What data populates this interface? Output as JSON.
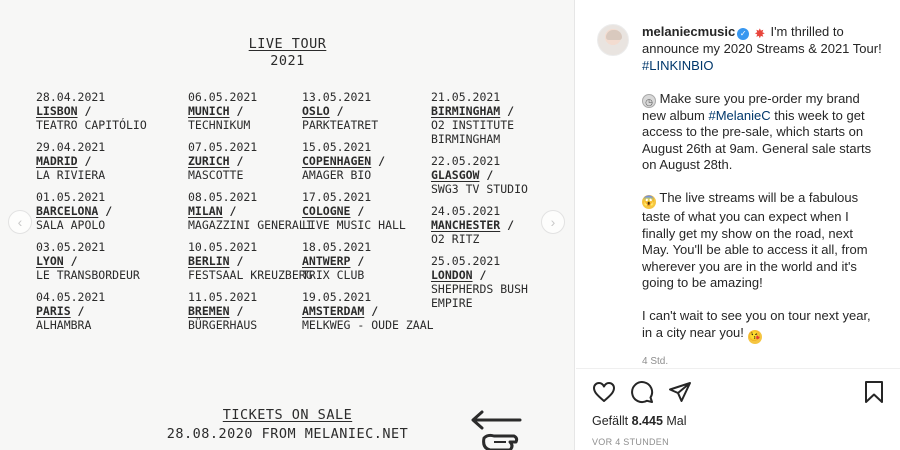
{
  "poster": {
    "title_line1": "LIVE TOUR",
    "title_line2": "2021",
    "columns": [
      [
        {
          "date": "28.04.2021",
          "city": "LISBON",
          "sep": " /",
          "venue": "TEATRO CAPITÓLIO"
        },
        {
          "date": "29.04.2021",
          "city": "MADRID",
          "sep": " /",
          "venue": "LA RIVIERA"
        },
        {
          "date": "01.05.2021",
          "city": "BARCELONA",
          "sep": " /",
          "venue": "SALA APOLO"
        },
        {
          "date": "03.05.2021",
          "city": "LYON",
          "sep": " /",
          "venue": "LE TRANSBORDEUR"
        },
        {
          "date": "04.05.2021",
          "city": "PARIS",
          "sep": " /",
          "venue": "ALHAMBRA"
        }
      ],
      [
        {
          "date": "06.05.2021",
          "city": "MUNICH",
          "sep": " /",
          "venue": "TECHNIKUM"
        },
        {
          "date": "07.05.2021",
          "city": "ZURICH",
          "sep": " /",
          "venue": "MASCOTTE"
        },
        {
          "date": "08.05.2021",
          "city": "MILAN",
          "sep": " /",
          "venue": "MAGAZZINI GENERALI"
        },
        {
          "date": "10.05.2021",
          "city": "BERLIN",
          "sep": " /",
          "venue": "FESTSAAL KREUZBERG"
        },
        {
          "date": "11.05.2021",
          "city": "BREMEN",
          "sep": " /",
          "venue": "BÜRGERHAUS"
        }
      ],
      [
        {
          "date": "13.05.2021",
          "city": "OSLO",
          "sep": " /",
          "venue": "PARKTEATRET"
        },
        {
          "date": "15.05.2021",
          "city": "COPENHAGEN",
          "sep": " /",
          "venue": "AMAGER BIO"
        },
        {
          "date": "17.05.2021",
          "city": "COLOGNE",
          "sep": " /",
          "venue": "LIVE MUSIC HALL"
        },
        {
          "date": "18.05.2021",
          "city": "ANTWERP",
          "sep": " /",
          "venue": "TRIX CLUB"
        },
        {
          "date": "19.05.2021",
          "city": "AMSTERDAM",
          "sep": " /",
          "venue": "MELKWEG - OUDE ZAAL"
        }
      ],
      [
        {
          "date": "21.05.2021",
          "city": "BIRMINGHAM",
          "sep": " /",
          "venue": "O2 INSTITUTE BIRMINGHAM"
        },
        {
          "date": "22.05.2021",
          "city": "GLASGOW",
          "sep": " /",
          "venue": "SWG3 TV STUDIO"
        },
        {
          "date": "24.05.2021",
          "city": "MANCHESTER",
          "sep": " /",
          "venue": "O2 RITZ"
        },
        {
          "date": "25.05.2021",
          "city": "LONDON",
          "sep": " /",
          "venue": "SHEPHERDS BUSH EMPIRE"
        }
      ]
    ],
    "tickets_line1": "TICKETS ON SALE",
    "tickets_line2": "28.08.2020 FROM MELANIEC.NET",
    "nav_left_icon": "chevron-left-icon",
    "nav_right_icon": "chevron-right-icon",
    "nav_left_glyph": "‹",
    "nav_right_glyph": "›"
  },
  "post": {
    "username": "melaniecmusic",
    "verified_icon": "verified-badge-icon",
    "verified_glyph": "✓",
    "p1_emoji": "✸",
    "p1_text": " I'm thrilled to announce my 2020 Streams & 2021 Tour! ",
    "p1_tag": "#LINKINBIO",
    "p2_emoji": "◷",
    "p2_text_a": " Make sure you pre-order my brand new album ",
    "p2_tag": "#MelanieC",
    "p2_text_b": " this week to get access to the pre-sale, which starts on August 26th at 9am. General sale starts on August 28th.",
    "p3_emoji": "😱",
    "p3_text": " The live streams will be a fabulous taste of what you can expect when I finally get my show on the road, next May. You'll be able to access it all, from wherever you are in the world and it's going to be amazing!",
    "p4_text": "I can't wait to see you on tour next year, in a city near you! ",
    "p4_emoji": "😘",
    "time_small": "4 Std.",
    "likes_label": "Gefällt",
    "likes_count": "8.445",
    "likes_unit": "Mal",
    "posted_ago": "VOR 4 STUNDEN"
  },
  "colors": {
    "link": "#00376b",
    "verified": "#3897f0",
    "muted": "#8e8e8e",
    "text": "#262626"
  }
}
